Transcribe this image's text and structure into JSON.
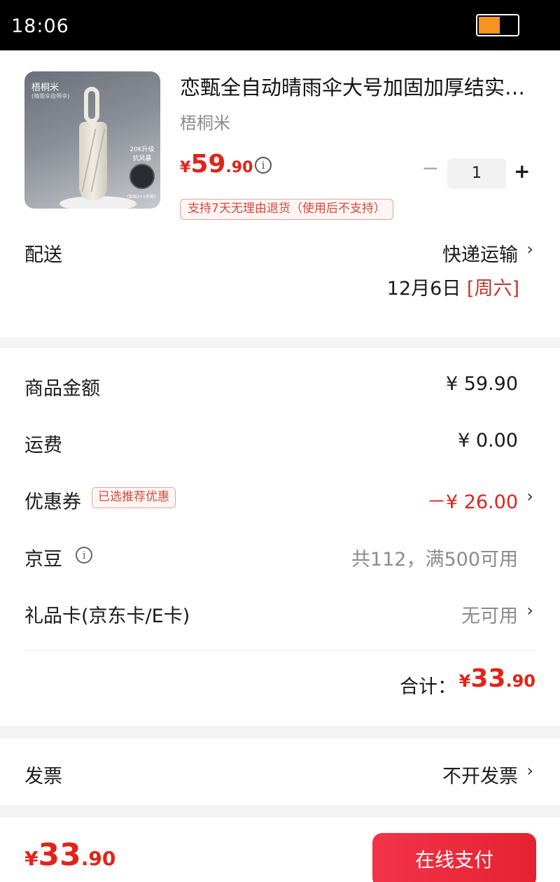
{
  "status_bar": {
    "time": "18:06",
    "battery_level": 0.55,
    "battery_color": "#f7931e"
  },
  "product": {
    "title": "恋甄全自动晴雨伞大号加固加厚结实…",
    "brand": "梧桐米",
    "image_text": {
      "brand": "梧桐米",
      "brand_sub": "(晴雨伞自带伞)",
      "feature": "20K升级\n抗风暴",
      "note": "(加固2+1伞骨)"
    },
    "price": {
      "currency": "¥",
      "integer": "59",
      "decimal": ".90"
    },
    "info_icon": "ⓘ",
    "quantity": {
      "minus": "−",
      "value": "1",
      "plus": "+"
    },
    "return_policy": "支持7天无理由退货（使用后不支持）"
  },
  "delivery": {
    "label": "配送",
    "method": "快递运输",
    "date": "12月6日",
    "weekday": "[周六]"
  },
  "summary": {
    "goods_amount": {
      "label": "商品金额",
      "value": "¥ 59.90"
    },
    "shipping": {
      "label": "运费",
      "value": "¥ 0.00"
    },
    "coupon": {
      "label": "优惠券",
      "tag": "已选推荐优惠",
      "value": "－¥ 26.00"
    },
    "jd_beans": {
      "label": "京豆",
      "value": "共112，满500可用"
    },
    "gift_card": {
      "label": "礼品卡(京东卡/E卡)",
      "value": "无可用"
    },
    "total": {
      "label": "合计：",
      "currency": "¥",
      "integer": "33",
      "decimal": ".90"
    }
  },
  "invoice": {
    "label": "发票",
    "value": "不开发票"
  },
  "footer": {
    "currency": "¥",
    "integer": "33",
    "decimal": ".90",
    "pay_label": "在线支付"
  },
  "colors": {
    "accent_red": "#e2231a",
    "pay_button": "#e52230"
  },
  "icons": {
    "chevron": "›",
    "info": "info-circle-icon"
  }
}
